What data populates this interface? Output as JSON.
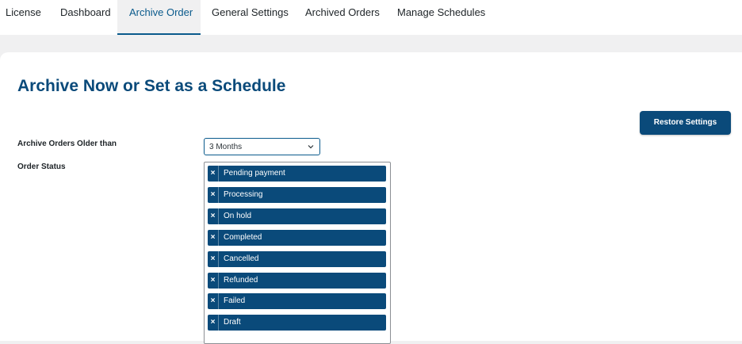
{
  "nav": {
    "tabs": [
      {
        "label": "License"
      },
      {
        "label": "Dashboard"
      },
      {
        "label": "Archive Order",
        "active": true
      },
      {
        "label": "General Settings"
      },
      {
        "label": "Archived Orders"
      },
      {
        "label": "Manage Schedules"
      }
    ]
  },
  "main": {
    "title": "Archive Now or Set as a Schedule",
    "restore_button": "Restore Settings",
    "archive_older_than": {
      "label": "Archive Orders Older than",
      "value": "3 Months"
    },
    "order_status": {
      "label": "Order Status",
      "selected": [
        "Pending payment",
        "Processing",
        "On hold",
        "Completed",
        "Cancelled",
        "Refunded",
        "Failed",
        "Draft"
      ],
      "remove_glyph": "×"
    }
  },
  "colors": {
    "accent": "#0a4a7a",
    "tab_active": "#0a5a8c",
    "background": "#f0f0f1"
  }
}
